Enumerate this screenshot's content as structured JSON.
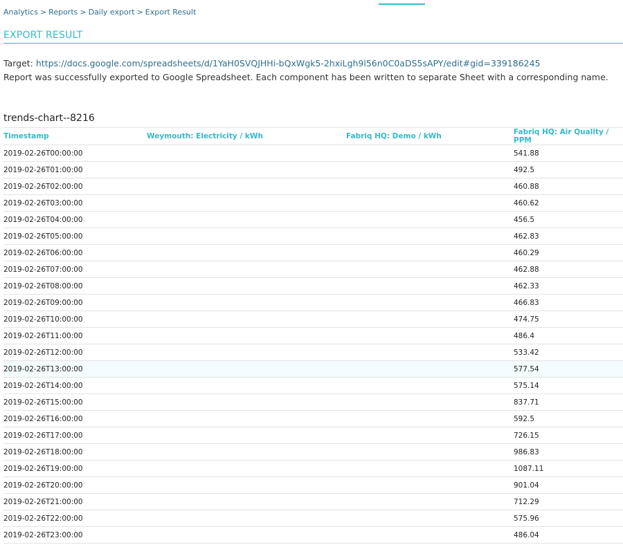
{
  "breadcrumb": {
    "items": [
      "Analytics",
      "Reports",
      "Daily export",
      "Export Result"
    ],
    "separator": ">"
  },
  "page": {
    "title": "EXPORT RESULT"
  },
  "result": {
    "target_label": "Target:",
    "target_url": "https://docs.google.com/spreadsheets/d/1YaH0SVQJHHi-bQxWgk5-2hxiLgh9l56n0C0aDS5sAPY/edit#gid=339186245",
    "message": "Report was successfully exported to Google Spreadsheet. Each component has been written to separate Sheet with a corresponding name."
  },
  "colors": {
    "accent": "#36b9c9",
    "link": "#2e6f8e",
    "row_highlight": "#f3fbfd"
  },
  "table": {
    "title": "trends-chart--8216",
    "columns": [
      "Timestamp",
      "Weymouth: Electricity / kWh",
      "Fabriq HQ: Demo / kWh",
      "Fabriq HQ: Air Quality / PPM"
    ],
    "highlighted_row": 13,
    "rows": [
      [
        "2019-02-26T00:00:00",
        "",
        "",
        "541.88"
      ],
      [
        "2019-02-26T01:00:00",
        "",
        "",
        "492.5"
      ],
      [
        "2019-02-26T02:00:00",
        "",
        "",
        "460.88"
      ],
      [
        "2019-02-26T03:00:00",
        "",
        "",
        "460.62"
      ],
      [
        "2019-02-26T04:00:00",
        "",
        "",
        "456.5"
      ],
      [
        "2019-02-26T05:00:00",
        "",
        "",
        "462.83"
      ],
      [
        "2019-02-26T06:00:00",
        "",
        "",
        "460.29"
      ],
      [
        "2019-02-26T07:00:00",
        "",
        "",
        "462.88"
      ],
      [
        "2019-02-26T08:00:00",
        "",
        "",
        "462.33"
      ],
      [
        "2019-02-26T09:00:00",
        "",
        "",
        "466.83"
      ],
      [
        "2019-02-26T10:00:00",
        "",
        "",
        "474.75"
      ],
      [
        "2019-02-26T11:00:00",
        "",
        "",
        "486.4"
      ],
      [
        "2019-02-26T12:00:00",
        "",
        "",
        "533.42"
      ],
      [
        "2019-02-26T13:00:00",
        "",
        "",
        "577.54"
      ],
      [
        "2019-02-26T14:00:00",
        "",
        "",
        "575.14"
      ],
      [
        "2019-02-26T15:00:00",
        "",
        "",
        "837.71"
      ],
      [
        "2019-02-26T16:00:00",
        "",
        "",
        "592.5"
      ],
      [
        "2019-02-26T17:00:00",
        "",
        "",
        "726.15"
      ],
      [
        "2019-02-26T18:00:00",
        "",
        "",
        "986.83"
      ],
      [
        "2019-02-26T19:00:00",
        "",
        "",
        "1087.11"
      ],
      [
        "2019-02-26T20:00:00",
        "",
        "",
        "901.04"
      ],
      [
        "2019-02-26T21:00:00",
        "",
        "",
        "712.29"
      ],
      [
        "2019-02-26T22:00:00",
        "",
        "",
        "575.96"
      ],
      [
        "2019-02-26T23:00:00",
        "",
        "",
        "486.04"
      ]
    ]
  }
}
